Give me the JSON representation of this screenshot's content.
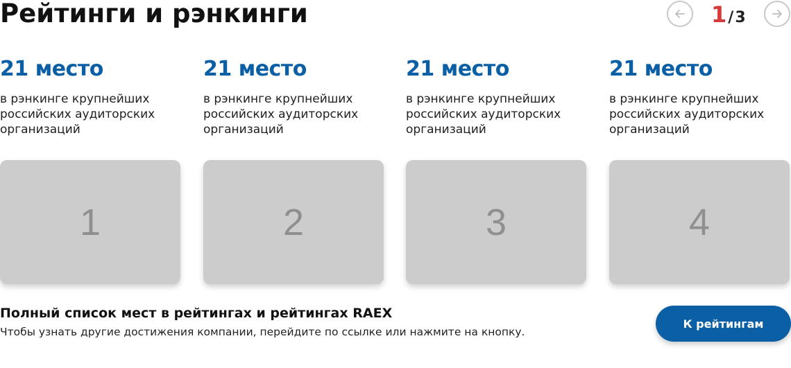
{
  "header": {
    "title": "Рейтинги и рэнкинги"
  },
  "pager": {
    "prev_icon": "arrow-left-icon",
    "next_icon": "arrow-right-icon",
    "current": "1",
    "separator": "/",
    "total": "3",
    "current_color": "#d63a3a"
  },
  "cards": [
    {
      "place": "21 место",
      "description": "в рэнкинге крупнейших российских аудиторских организаций",
      "image_label": "1"
    },
    {
      "place": "21 место",
      "description": "в рэнкинге крупнейших российских аудиторских организаций",
      "image_label": "2"
    },
    {
      "place": "21 место",
      "description": "в рэнкинге крупнейших российских аудиторских организаций",
      "image_label": "3"
    },
    {
      "place": "21 место",
      "description": "в рэнкинге крупнейших российских аудиторских организаций",
      "image_label": "4"
    }
  ],
  "footer": {
    "title": "Полный список мест в рейтингах и рейтингах RAEX",
    "text": "Чтобы узнать другие достижения компании, перейдите по ссылке или нажмите на кнопку.",
    "button_label": "К рейтингам"
  },
  "colors": {
    "accent": "#0b5fa5",
    "placeholder": "#cccccc",
    "highlight": "#d63a3a"
  }
}
